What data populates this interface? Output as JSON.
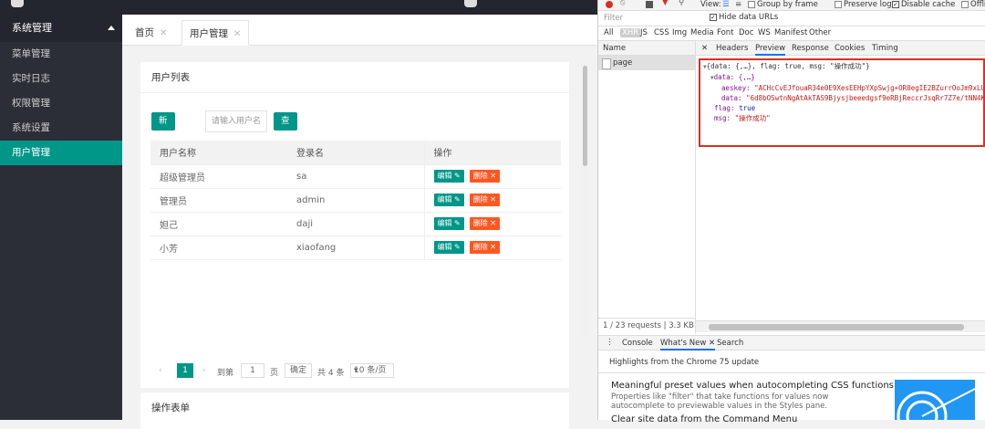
{
  "sidebar": {
    "header": "系统管理",
    "items": [
      {
        "label": "菜单管理"
      },
      {
        "label": "实时日志"
      },
      {
        "label": "权限管理"
      },
      {
        "label": "系统设置"
      },
      {
        "label": "用户管理",
        "active": true
      }
    ]
  },
  "tabs": [
    {
      "label": "首页"
    },
    {
      "label": "用户管理",
      "active": true
    }
  ],
  "user_list": {
    "title": "用户列表",
    "add_button": "新增",
    "search_placeholder": "请输入用户名",
    "search_button": "查询",
    "columns": [
      "用户名称",
      "登录名",
      "操作"
    ],
    "rows": [
      {
        "name": "超级管理员",
        "login": "sa"
      },
      {
        "name": "管理员",
        "login": "admin"
      },
      {
        "name": "妲己",
        "login": "daji"
      },
      {
        "name": "小芳",
        "login": "xiaofang"
      }
    ],
    "edit_label": "编辑",
    "delete_label": "删除",
    "pager": {
      "current": "1",
      "goto_label": "到第",
      "goto_value": "1",
      "page_unit": "页",
      "confirm": "确定",
      "total": "共 4 条",
      "page_size": "10 条/页"
    }
  },
  "second_card_title": "操作表单",
  "devtools": {
    "toolbar": {
      "view_label": "View:",
      "group_by_frame": "Group by frame",
      "preserve_log": "Preserve log",
      "disable_cache": "Disable cache",
      "offline": "Offli"
    },
    "filter_placeholder": "Filter",
    "hide_data_urls": "Hide data URLs",
    "type_filters": [
      "All",
      "XHR",
      "JS",
      "CSS",
      "Img",
      "Media",
      "Font",
      "Doc",
      "WS",
      "Manifest",
      "Other"
    ],
    "name_header": "Name",
    "request_name": "page",
    "detail_tabs": [
      "Headers",
      "Preview",
      "Response",
      "Cookies",
      "Timing"
    ],
    "preview_lines": {
      "root": "{data: {,…}, flag: true, msg: \"操作成功\"}",
      "data_root": "data: {,…}",
      "aeskey_key": "aeskey: ",
      "aeskey_val": "\"ACHcCvEJfouaR34e0E9XesEEHpYXpSwjg+OR0egIE2BZurrOoJm9xLUs",
      "data_key": "data: ",
      "data_val": "\"6d8bOSwtnNgAtAkTAS9Bjysjbeeedgsf9eRBjReccrJsqRr7Z7e/tNN4K2",
      "flag_key": "flag: ",
      "flag_val": "true",
      "msg_key": "msg: ",
      "msg_val": "\"操作成功\""
    },
    "status": "1 / 23 requests  |  3.3 KB /",
    "drawer_tabs": [
      "Console",
      "What's New",
      "Search"
    ],
    "whats_new": {
      "title": "Highlights from the Chrome 75 update",
      "h1": "Meaningful preset values when autocompleting CSS functions",
      "p1": "Properties like \"filter\" that take functions for values now autocomplete to previewable values in the Styles pane.",
      "h2": "Clear site data from the Command Menu"
    }
  }
}
